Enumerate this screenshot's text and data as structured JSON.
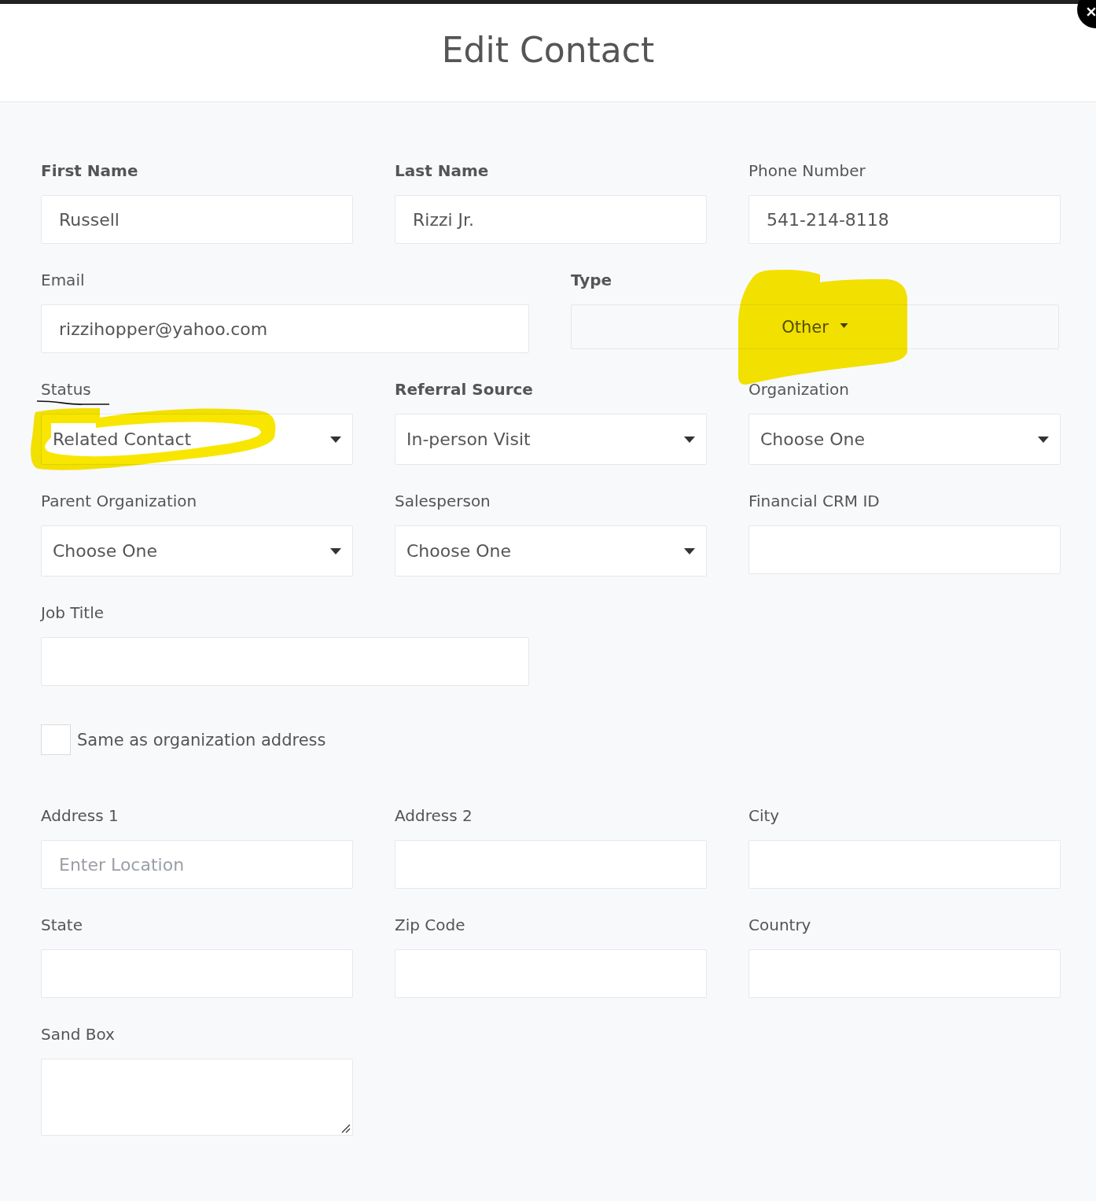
{
  "title": "Edit Contact",
  "rows": [
    {
      "kind": "third",
      "fields": [
        {
          "label": "First Name",
          "bold": true,
          "kind": "text",
          "value": "Russell"
        },
        {
          "label": "Last Name",
          "bold": true,
          "kind": "text",
          "value": "Rizzi Jr."
        },
        {
          "label": "Phone Number",
          "bold": false,
          "kind": "text",
          "value": "541-214-8118"
        }
      ]
    },
    {
      "kind": "half",
      "fields": [
        {
          "label": "Email",
          "bold": false,
          "kind": "text",
          "value": "rizzihopper@yahoo.com"
        },
        {
          "label": "Type",
          "bold": true,
          "kind": "centered-select",
          "value": "Other",
          "highlight": {
            "kind": "blob"
          }
        }
      ]
    },
    {
      "kind": "third",
      "fields": [
        {
          "label": "Status",
          "bold": false,
          "underlined": true,
          "kind": "select",
          "value": "Related Contact",
          "highlight": {
            "kind": "loop"
          }
        },
        {
          "label": "Referral Source",
          "bold": true,
          "kind": "select",
          "value": "In-person Visit"
        },
        {
          "label": "Organization",
          "bold": false,
          "kind": "select",
          "value": "Choose One"
        }
      ]
    },
    {
      "kind": "third",
      "fields": [
        {
          "label": "Parent Organization",
          "bold": false,
          "kind": "select",
          "value": "Choose One"
        },
        {
          "label": "Salesperson",
          "bold": false,
          "kind": "select",
          "value": "Choose One"
        },
        {
          "label": "Financial CRM ID",
          "bold": false,
          "kind": "text"
        }
      ]
    },
    {
      "kind": "half",
      "fields": [
        {
          "label": "Job Title",
          "bold": false,
          "kind": "text"
        }
      ]
    },
    {
      "kind": "checkbox",
      "label": "Same as organization address",
      "checked": false
    },
    {
      "kind": "third",
      "fields": [
        {
          "label": "Address 1",
          "bold": false,
          "kind": "text",
          "placeholder": "Enter Location"
        },
        {
          "label": "Address 2",
          "bold": false,
          "kind": "text"
        },
        {
          "label": "City",
          "bold": false,
          "kind": "text"
        }
      ]
    },
    {
      "kind": "third",
      "fields": [
        {
          "label": "State",
          "bold": false,
          "kind": "text"
        },
        {
          "label": "Zip Code",
          "bold": false,
          "kind": "text"
        },
        {
          "label": "Country",
          "bold": false,
          "kind": "text"
        }
      ]
    },
    {
      "kind": "third",
      "fields": [
        {
          "label": "Sand Box",
          "bold": false,
          "kind": "textarea"
        }
      ]
    }
  ]
}
